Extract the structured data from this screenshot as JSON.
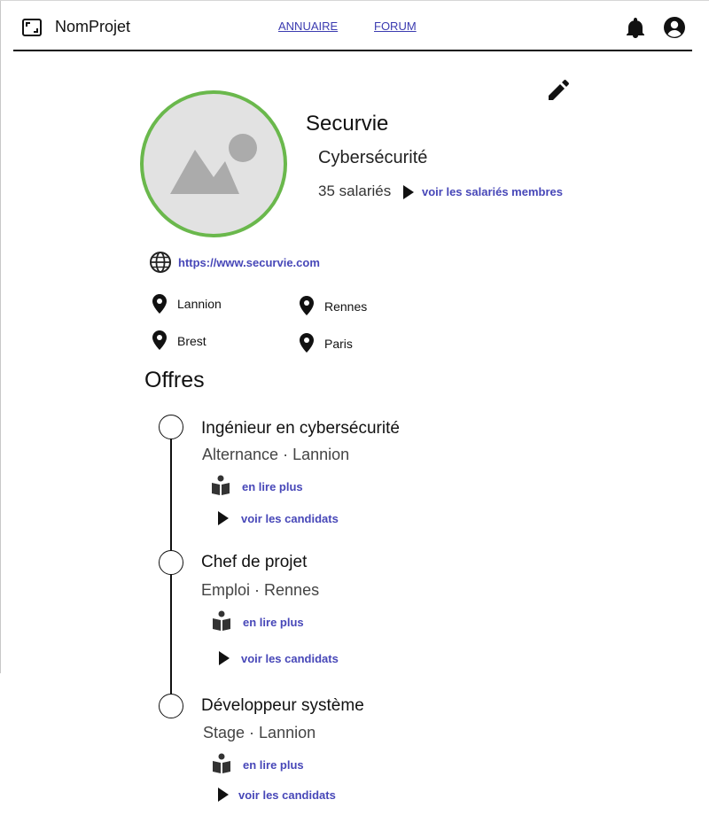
{
  "header": {
    "app_name": "NomProjet",
    "nav": [
      {
        "label": "ANNUAIRE"
      },
      {
        "label": "FORUM"
      }
    ],
    "icons": [
      "logo-frame-icon",
      "bell-icon",
      "account-circle-icon"
    ]
  },
  "company": {
    "name": "Securvie",
    "sector": "Cybersécurité",
    "employees": "35 salariés",
    "members_link": "voir les salariés membres",
    "website": "https://www.securvie.com",
    "locations": [
      "Lannion",
      "Rennes",
      "Brest",
      "Paris"
    ]
  },
  "offers_section": {
    "title": "Offres",
    "items": [
      {
        "title": "Ingénieur en cybersécurité",
        "type": "Alternance",
        "city": "Lannion",
        "read_more": "en lire plus",
        "candidates": "voir les candidats"
      },
      {
        "title": "Chef de projet",
        "type": "Emploi",
        "city": "Rennes",
        "read_more": "en lire plus",
        "candidates": "voir les candidats"
      },
      {
        "title": "Développeur système",
        "type": "Stage",
        "city": "Lannion",
        "read_more": "en lire plus",
        "candidates": "voir les candidats"
      }
    ]
  },
  "colors": {
    "accent_link": "#4747b8",
    "avatar_ring": "#6ab84c",
    "text": "#111111"
  }
}
